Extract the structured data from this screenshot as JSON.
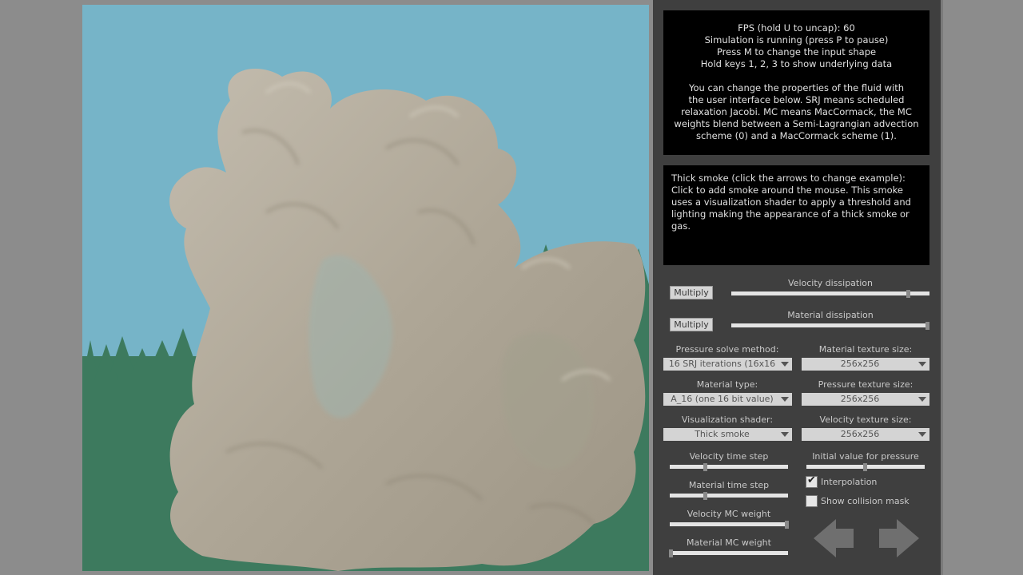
{
  "info": {
    "fps": "FPS (hold U to uncap): 60",
    "status": "Simulation is running (press P to pause)",
    "shape_hint": "Press M to change the input shape",
    "data_hint": "Hold keys 1, 2, 3 to show underlying data",
    "para": [
      "You can change the properties of the fluid with",
      "the user interface below. SRJ means scheduled",
      "relaxation Jacobi. MC means MacCormack, the MC",
      "weights blend between a Semi-Lagrangian advection",
      "scheme (0) and a MacCormack scheme (1)."
    ]
  },
  "description": {
    "lines": [
      "Thick smoke (click the arrows to change example):",
      "Click to add smoke around the mouse. This smoke",
      "uses a visualization shader to apply a threshold and",
      "lighting making the appearance of a thick smoke or",
      "gas."
    ]
  },
  "controls": {
    "velocity_dissipation": {
      "button": "Multiply",
      "label": "Velocity dissipation",
      "value": 0.9
    },
    "material_dissipation": {
      "button": "Multiply",
      "label": "Material dissipation",
      "value": 1.0
    },
    "pressure_solve": {
      "label": "Pressure solve method:",
      "value": "16 SRJ iterations (16x16"
    },
    "material_texture": {
      "label": "Material texture size:",
      "value": "256x256"
    },
    "material_type": {
      "label": "Material type:",
      "value": "A_16 (one 16 bit value)"
    },
    "pressure_texture": {
      "label": "Pressure texture size:",
      "value": "256x256"
    },
    "vis_shader": {
      "label": "Visualization shader:",
      "value": "Thick smoke"
    },
    "velocity_texture": {
      "label": "Velocity texture size:",
      "value": "256x256"
    },
    "velocity_time_step": {
      "label": "Velocity time step",
      "value": 0.3
    },
    "initial_pressure": {
      "label": "Initial value for pressure",
      "value": 0.5
    },
    "material_time_step": {
      "label": "Material time step",
      "value": 0.3
    },
    "interpolation": {
      "label": "Interpolation",
      "checked": true
    },
    "velocity_mc_weight": {
      "label": "Velocity MC weight",
      "value": 1.0
    },
    "collision_mask": {
      "label": "Show collision mask",
      "checked": false
    },
    "material_mc_weight": {
      "label": "Material MC weight",
      "value": 0.0
    }
  },
  "icons": {
    "prev": "arrow-left-icon",
    "next": "arrow-right-icon",
    "check": "check-icon"
  },
  "colors": {
    "sky": "#76b4c8",
    "trees": "#3d7a5e",
    "smoke": "#b1a999",
    "panel": "#3f3f3f"
  }
}
